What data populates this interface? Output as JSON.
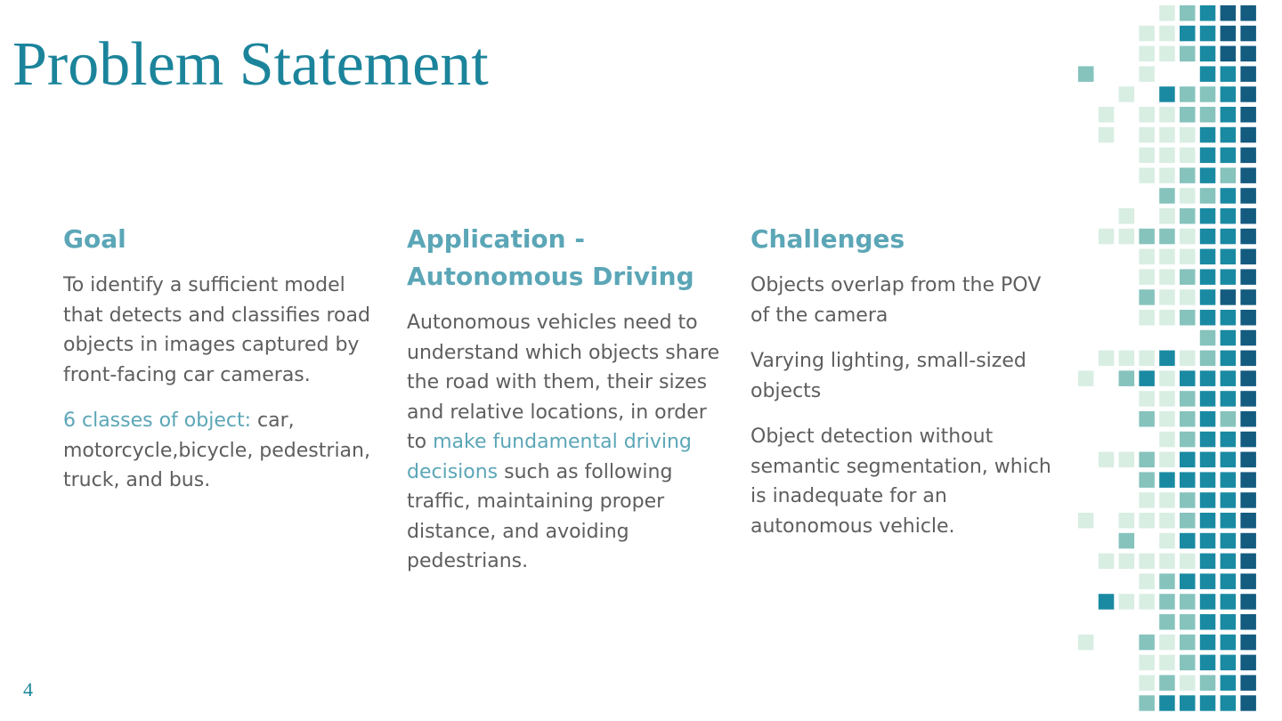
{
  "slide": {
    "title": "Problem Statement",
    "page_number": "4"
  },
  "columns": {
    "goal": {
      "heading": "Goal",
      "paragraph1": "To identify a sufficient model that detects and classifies road objects in images captured by front-facing car cameras.",
      "classes_label": "6 classes of object:",
      "classes_text": " car, motorcycle,bicycle, pedestrian, truck, and bus."
    },
    "application": {
      "heading_line1": "Application -",
      "heading_line2": "Autonomous Driving",
      "text_before": "Autonomous vehicles need to understand which objects share the road with them, their sizes and relative locations, in order to ",
      "highlight": "make fundamental driving decisions",
      "text_after": " such as following traffic, maintaining proper distance, and avoiding pedestrians."
    },
    "challenges": {
      "heading": "Challenges",
      "items": [
        "Objects overlap from the POV of the camera",
        "Varying lighting, small-sized objects",
        "Object detection without semantic segmentation, which is inadequate for an autonomous vehicle."
      ]
    }
  },
  "colors": {
    "title": "#1b849b",
    "heading": "#5ba6b7",
    "body_text": "#5e5e5e",
    "highlight": "#5ba6b7",
    "mosaic": [
      "#d9eee3",
      "#86c3bd",
      "#1a8aa3",
      "#145b80"
    ]
  }
}
